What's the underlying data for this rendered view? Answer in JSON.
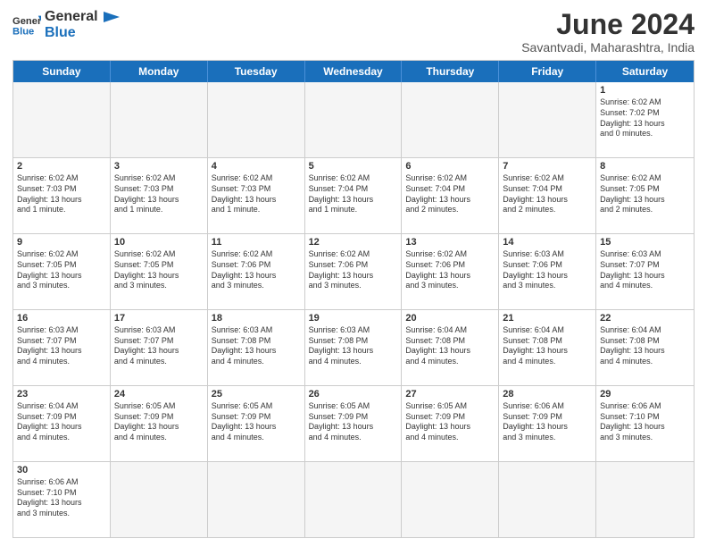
{
  "header": {
    "logo_general": "General",
    "logo_blue": "Blue",
    "title": "June 2024",
    "subtitle": "Savantvadi, Maharashtra, India"
  },
  "days_of_week": [
    "Sunday",
    "Monday",
    "Tuesday",
    "Wednesday",
    "Thursday",
    "Friday",
    "Saturday"
  ],
  "weeks": [
    [
      {
        "day": "",
        "empty": true
      },
      {
        "day": "",
        "empty": true
      },
      {
        "day": "",
        "empty": true
      },
      {
        "day": "",
        "empty": true
      },
      {
        "day": "",
        "empty": true
      },
      {
        "day": "",
        "empty": true
      },
      {
        "day": "1",
        "info": "Sunrise: 6:02 AM\nSunset: 7:02 PM\nDaylight: 13 hours\nand 0 minutes."
      }
    ],
    [
      {
        "day": "2",
        "info": "Sunrise: 6:02 AM\nSunset: 7:03 PM\nDaylight: 13 hours\nand 1 minute."
      },
      {
        "day": "3",
        "info": "Sunrise: 6:02 AM\nSunset: 7:03 PM\nDaylight: 13 hours\nand 1 minute."
      },
      {
        "day": "4",
        "info": "Sunrise: 6:02 AM\nSunset: 7:03 PM\nDaylight: 13 hours\nand 1 minute."
      },
      {
        "day": "5",
        "info": "Sunrise: 6:02 AM\nSunset: 7:04 PM\nDaylight: 13 hours\nand 1 minute."
      },
      {
        "day": "6",
        "info": "Sunrise: 6:02 AM\nSunset: 7:04 PM\nDaylight: 13 hours\nand 2 minutes."
      },
      {
        "day": "7",
        "info": "Sunrise: 6:02 AM\nSunset: 7:04 PM\nDaylight: 13 hours\nand 2 minutes."
      },
      {
        "day": "8",
        "info": "Sunrise: 6:02 AM\nSunset: 7:05 PM\nDaylight: 13 hours\nand 2 minutes."
      }
    ],
    [
      {
        "day": "9",
        "info": "Sunrise: 6:02 AM\nSunset: 7:05 PM\nDaylight: 13 hours\nand 3 minutes."
      },
      {
        "day": "10",
        "info": "Sunrise: 6:02 AM\nSunset: 7:05 PM\nDaylight: 13 hours\nand 3 minutes."
      },
      {
        "day": "11",
        "info": "Sunrise: 6:02 AM\nSunset: 7:06 PM\nDaylight: 13 hours\nand 3 minutes."
      },
      {
        "day": "12",
        "info": "Sunrise: 6:02 AM\nSunset: 7:06 PM\nDaylight: 13 hours\nand 3 minutes."
      },
      {
        "day": "13",
        "info": "Sunrise: 6:02 AM\nSunset: 7:06 PM\nDaylight: 13 hours\nand 3 minutes."
      },
      {
        "day": "14",
        "info": "Sunrise: 6:03 AM\nSunset: 7:06 PM\nDaylight: 13 hours\nand 3 minutes."
      },
      {
        "day": "15",
        "info": "Sunrise: 6:03 AM\nSunset: 7:07 PM\nDaylight: 13 hours\nand 4 minutes."
      }
    ],
    [
      {
        "day": "16",
        "info": "Sunrise: 6:03 AM\nSunset: 7:07 PM\nDaylight: 13 hours\nand 4 minutes."
      },
      {
        "day": "17",
        "info": "Sunrise: 6:03 AM\nSunset: 7:07 PM\nDaylight: 13 hours\nand 4 minutes."
      },
      {
        "day": "18",
        "info": "Sunrise: 6:03 AM\nSunset: 7:08 PM\nDaylight: 13 hours\nand 4 minutes."
      },
      {
        "day": "19",
        "info": "Sunrise: 6:03 AM\nSunset: 7:08 PM\nDaylight: 13 hours\nand 4 minutes."
      },
      {
        "day": "20",
        "info": "Sunrise: 6:04 AM\nSunset: 7:08 PM\nDaylight: 13 hours\nand 4 minutes."
      },
      {
        "day": "21",
        "info": "Sunrise: 6:04 AM\nSunset: 7:08 PM\nDaylight: 13 hours\nand 4 minutes."
      },
      {
        "day": "22",
        "info": "Sunrise: 6:04 AM\nSunset: 7:08 PM\nDaylight: 13 hours\nand 4 minutes."
      }
    ],
    [
      {
        "day": "23",
        "info": "Sunrise: 6:04 AM\nSunset: 7:09 PM\nDaylight: 13 hours\nand 4 minutes."
      },
      {
        "day": "24",
        "info": "Sunrise: 6:05 AM\nSunset: 7:09 PM\nDaylight: 13 hours\nand 4 minutes."
      },
      {
        "day": "25",
        "info": "Sunrise: 6:05 AM\nSunset: 7:09 PM\nDaylight: 13 hours\nand 4 minutes."
      },
      {
        "day": "26",
        "info": "Sunrise: 6:05 AM\nSunset: 7:09 PM\nDaylight: 13 hours\nand 4 minutes."
      },
      {
        "day": "27",
        "info": "Sunrise: 6:05 AM\nSunset: 7:09 PM\nDaylight: 13 hours\nand 4 minutes."
      },
      {
        "day": "28",
        "info": "Sunrise: 6:06 AM\nSunset: 7:09 PM\nDaylight: 13 hours\nand 3 minutes."
      },
      {
        "day": "29",
        "info": "Sunrise: 6:06 AM\nSunset: 7:10 PM\nDaylight: 13 hours\nand 3 minutes."
      }
    ],
    [
      {
        "day": "30",
        "info": "Sunrise: 6:06 AM\nSunset: 7:10 PM\nDaylight: 13 hours\nand 3 minutes."
      },
      {
        "day": "",
        "empty": true
      },
      {
        "day": "",
        "empty": true
      },
      {
        "day": "",
        "empty": true
      },
      {
        "day": "",
        "empty": true
      },
      {
        "day": "",
        "empty": true
      },
      {
        "day": "",
        "empty": true
      }
    ]
  ]
}
